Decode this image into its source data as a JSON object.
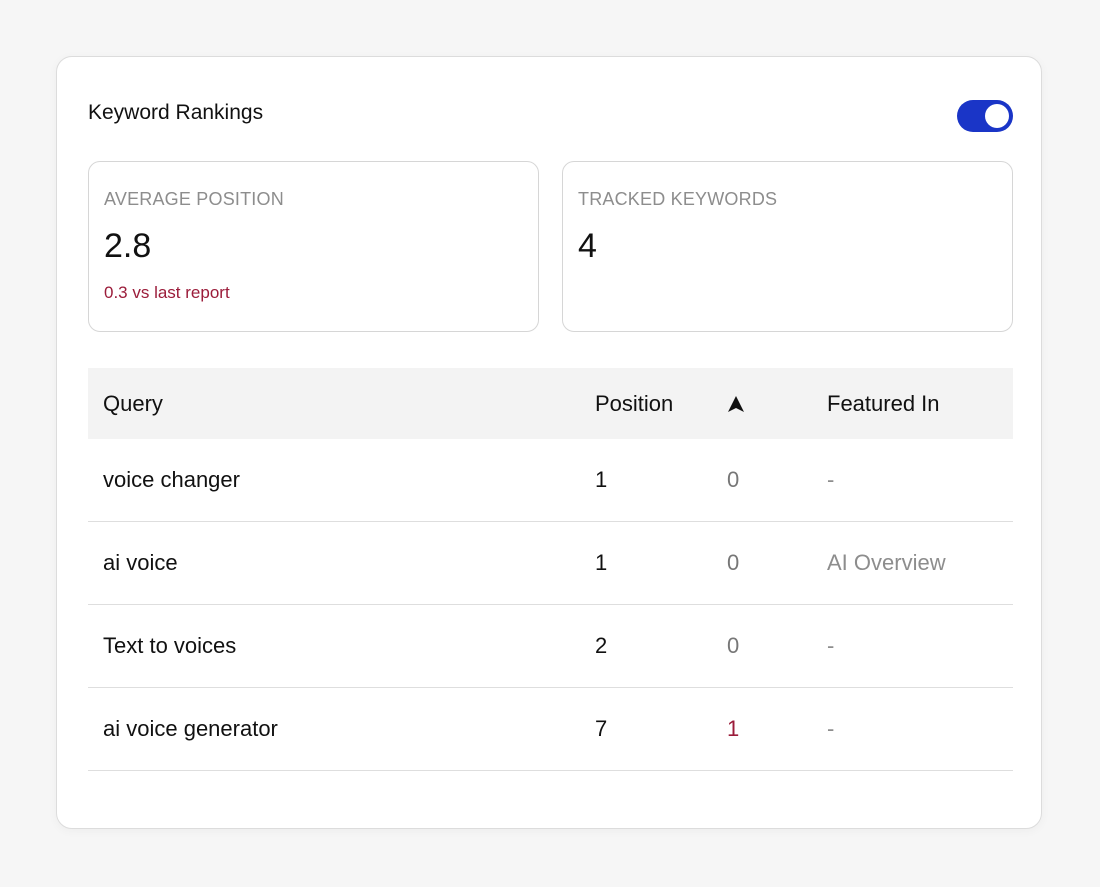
{
  "card": {
    "title": "Keyword Rankings",
    "toggle_on": true
  },
  "colors": {
    "accent": "#1a35c7",
    "negative_text": "#9b1c3a",
    "muted_text": "#8d8d8d"
  },
  "stats": {
    "average_position": {
      "label": "AVERAGE POSITION",
      "value": "2.8",
      "delta": "0.3 vs last report"
    },
    "tracked_keywords": {
      "label": "TRACKED KEYWORDS",
      "value": "4"
    }
  },
  "table": {
    "headers": {
      "query": "Query",
      "position": "Position",
      "delta_icon": "triangle-up-icon",
      "featured": "Featured In"
    },
    "rows": [
      {
        "query": "voice changer",
        "position": "1",
        "delta": "0",
        "featured": "-"
      },
      {
        "query": "ai voice",
        "position": "1",
        "delta": "0",
        "featured": "AI Overview"
      },
      {
        "query": "Text to voices",
        "position": "2",
        "delta": "0",
        "featured": "-"
      },
      {
        "query": "ai voice generator",
        "position": "7",
        "delta": "1",
        "featured": "-"
      }
    ]
  }
}
